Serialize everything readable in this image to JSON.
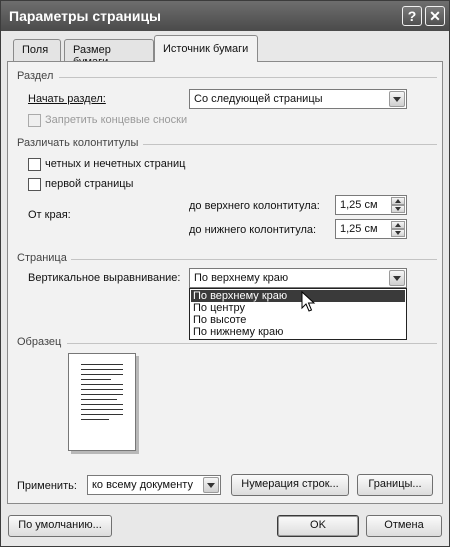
{
  "window": {
    "title": "Параметры страницы",
    "help_glyph": "?",
    "close_glyph": "✕"
  },
  "tabs": [
    {
      "label": "Поля",
      "active": false
    },
    {
      "label": "Размер бумаги",
      "active": false
    },
    {
      "label": "Источник бумаги",
      "active": true
    }
  ],
  "section": {
    "title": "Раздел",
    "start_label": "Начать раздел:",
    "start_value": "Со следующей страницы",
    "suppress_endnotes_label": "Запретить концевые сноски",
    "suppress_endnotes_checked": false,
    "suppress_endnotes_disabled": true
  },
  "headers_footers": {
    "title": "Различать колонтитулы",
    "odd_even_label": "четных и нечетных страниц",
    "odd_even_checked": false,
    "first_page_label": "первой страницы",
    "first_page_checked": false,
    "from_edge_label": "От края:",
    "header_label": "до верхнего колонтитула:",
    "header_value": "1,25 см",
    "footer_label": "до нижнего колонтитула:",
    "footer_value": "1,25 см"
  },
  "page": {
    "title": "Страница",
    "valign_label": "Вертикальное выравнивание:",
    "valign_value": "По верхнему краю",
    "valign_options": [
      "По верхнему краю",
      "По центру",
      "По высоте",
      "По нижнему краю"
    ],
    "valign_selected_index": 0
  },
  "preview": {
    "title": "Образец"
  },
  "apply": {
    "label": "Применить:",
    "value": "ко всему документу",
    "line_numbers_button": "Нумерация строк...",
    "borders_button": "Границы..."
  },
  "footer": {
    "default_button": "По умолчанию...",
    "ok_button": "OK",
    "cancel_button": "Отмена"
  },
  "colors": {
    "titlebar": "#4a4a4a",
    "dialog_bg": "#e8e8e8",
    "panel_bg": "#f2f2f2",
    "selection": "#3a3a3a"
  }
}
